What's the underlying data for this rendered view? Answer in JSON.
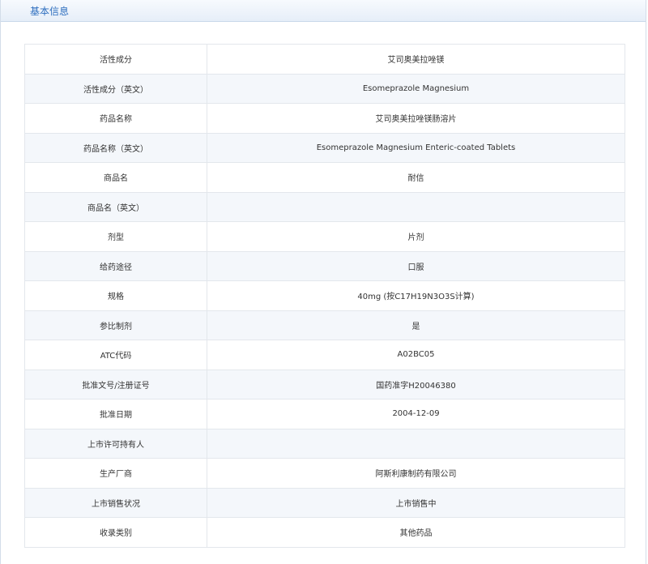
{
  "panel": {
    "title": "基本信息"
  },
  "rows": [
    {
      "label": "活性成分",
      "value": "艾司奥美拉唑镁"
    },
    {
      "label": "活性成分（英文）",
      "value": "Esomeprazole Magnesium"
    },
    {
      "label": "药品名称",
      "value": "艾司奥美拉唑镁肠溶片"
    },
    {
      "label": "药品名称（英文）",
      "value": "Esomeprazole Magnesium Enteric-coated Tablets"
    },
    {
      "label": "商品名",
      "value": "耐信"
    },
    {
      "label": "商品名（英文）",
      "value": ""
    },
    {
      "label": "剂型",
      "value": "片剂"
    },
    {
      "label": "给药途径",
      "value": "口服"
    },
    {
      "label": "规格",
      "value": "40mg (按C17H19N3O3S计算)"
    },
    {
      "label": "参比制剂",
      "value": "是"
    },
    {
      "label": "ATC代码",
      "value": "A02BC05"
    },
    {
      "label": "批准文号/注册证号",
      "value": "国药准字H20046380"
    },
    {
      "label": "批准日期",
      "value": "2004-12-09"
    },
    {
      "label": "上市许可持有人",
      "value": ""
    },
    {
      "label": "生产厂商",
      "value": "阿斯利康制药有限公司"
    },
    {
      "label": "上市销售状况",
      "value": "上市销售中"
    },
    {
      "label": "收录类别",
      "value": "其他药品"
    }
  ],
  "colors": {
    "title": "#2f6fbf",
    "row_alt": "#f4f7fb",
    "border": "#e3e7ec"
  }
}
